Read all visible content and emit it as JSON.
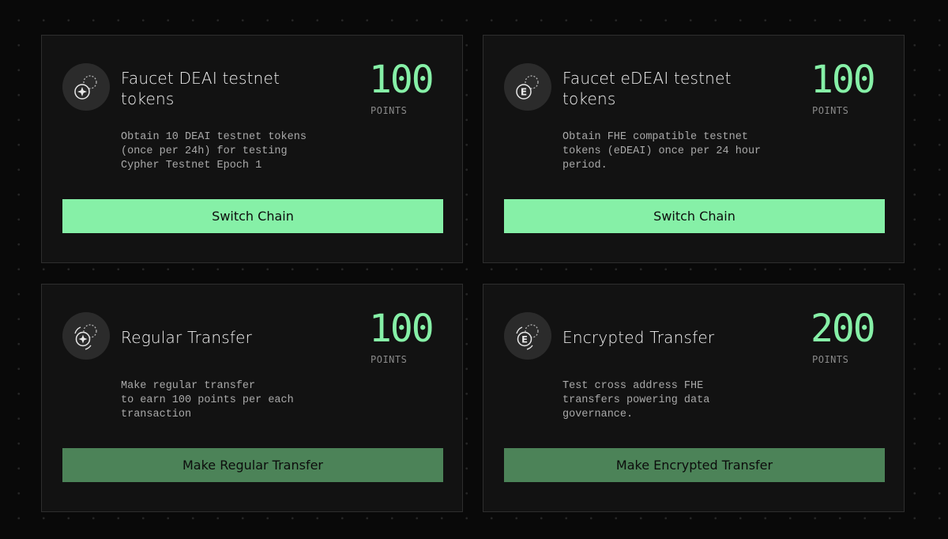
{
  "colors": {
    "accent": "#86f0a7",
    "accent_muted": "#4c8358",
    "card_bg": "#121212",
    "page_bg": "#090909"
  },
  "cards": [
    {
      "icon": "deai-token-icon",
      "title": "Faucet DEAI testnet tokens",
      "points": "100",
      "points_label": "POINTS",
      "description": "Obtain 10 DEAI testnet tokens\n(once per 24h) for testing\nCypher Testnet Epoch 1",
      "button": "Switch Chain"
    },
    {
      "icon": "edeai-token-icon",
      "title": "Faucet eDEAI testnet tokens",
      "points": "100",
      "points_label": "POINTS",
      "description": "Obtain FHE compatible testnet\ntokens (eDEAI) once per 24 hour\nperiod.",
      "button": "Switch Chain"
    },
    {
      "icon": "regular-transfer-icon",
      "title": "Regular Transfer",
      "points": "100",
      "points_label": "POINTS",
      "description": "Make regular transfer\nto earn 100 points per each\ntransaction",
      "button": "Make Regular Transfer"
    },
    {
      "icon": "encrypted-transfer-icon",
      "title": "Encrypted Transfer",
      "points": "200",
      "points_label": "POINTS",
      "description": "Test cross address FHE\ntransfers powering data\ngovernance.",
      "button": "Make Encrypted Transfer"
    }
  ]
}
